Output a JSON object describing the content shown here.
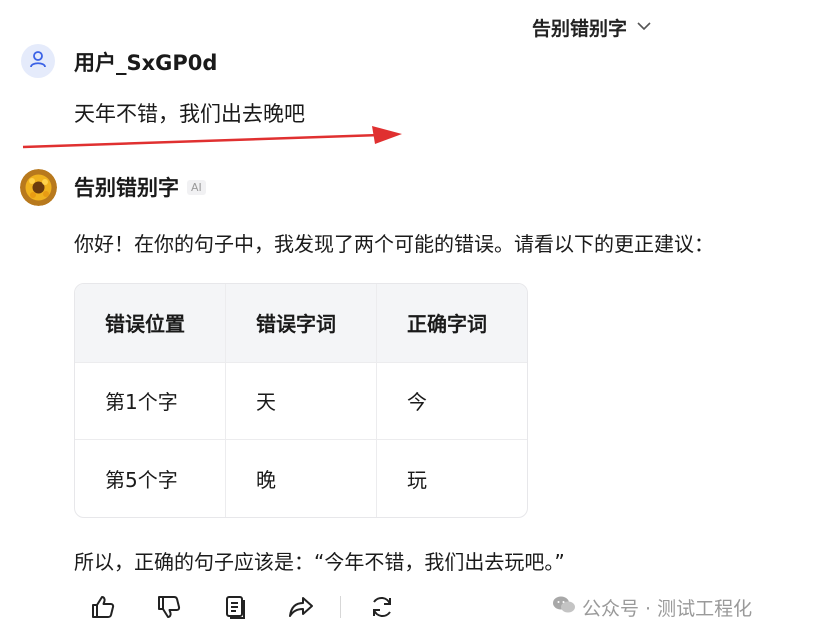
{
  "header": {
    "title": "告别错别字",
    "dropdown_icon": "chevron-down-icon"
  },
  "user": {
    "name": "用户_SxGP0d",
    "message": "天年不错，我们出去晚吧",
    "avatar_icon": "user-icon"
  },
  "bot": {
    "name": "告别错别字",
    "badge": "AI",
    "intro": "你好！在你的句子中，我发现了两个可能的错误。请看以下的更正建议：",
    "table": {
      "headers": [
        "错误位置",
        "错误字词",
        "正确字词"
      ],
      "rows": [
        [
          "第1个字",
          "天",
          "今"
        ],
        [
          "第5个字",
          "晚",
          "玩"
        ]
      ]
    },
    "conclusion": "所以，正确的句子应该是：“今年不错，我们出去玩吧。”"
  },
  "actions": [
    "thumbs-up-icon",
    "thumbs-down-icon",
    "copy-icon",
    "share-icon",
    "regenerate-icon"
  ],
  "watermark": "公众号 · 测试工程化",
  "colors": {
    "arrow": "#e03030",
    "user_avatar_bg": "#e5ebfb",
    "user_avatar_icon": "#3b62e6"
  }
}
